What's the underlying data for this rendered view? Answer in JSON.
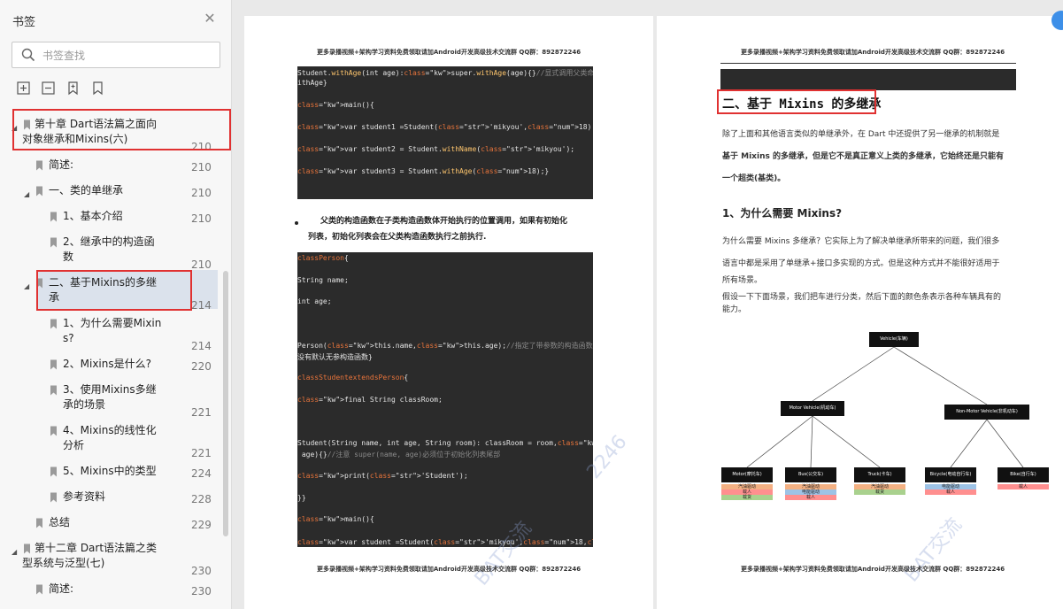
{
  "sidebar": {
    "title": "书签",
    "search_placeholder": "书签查找",
    "toc": [
      {
        "label": "第十章 Dart语法篇之面向",
        "label2": "对象继承和Mixins(六)",
        "page": "210"
      },
      {
        "label": "简述:",
        "page": "210"
      },
      {
        "label": "一、类的单继承",
        "page": "210"
      },
      {
        "label": "1、基本介绍",
        "page": "210"
      },
      {
        "label": "2、继承中的构造函",
        "label2": "数",
        "page": "210"
      },
      {
        "label": "二、基于Mixins的多继",
        "label2": "承",
        "page": "214"
      },
      {
        "label": "1、为什么需要Mixin",
        "label2": "s?",
        "page": "214"
      },
      {
        "label": "2、Mixins是什么?",
        "page": "220"
      },
      {
        "label": "3、使用Mixins多继",
        "label2": "承的场景",
        "page": "221"
      },
      {
        "label": "4、Mixins的线性化",
        "label2": "分析",
        "page": "221"
      },
      {
        "label": "5、Mixins中的类型",
        "page": "224"
      },
      {
        "label": "参考资料",
        "page": "228"
      },
      {
        "label": "总结",
        "page": "229"
      },
      {
        "label": "第十二章 Dart语法篇之类",
        "label2": "型系统与泛型(七)",
        "page": "230"
      },
      {
        "label": "简述:",
        "page": "230"
      }
    ]
  },
  "page_header": "更多录播视频+架构学习资料免费领取请加Android开发高级技术交流群 QQ群：892872246",
  "left_page": {
    "code1": [
      "Student.withAge(int age):super.withAge(age){}//显式调用父类命名构造函数 w",
      "ithAge}",
      "",
      "main(){",
      "",
      "var student1 =Student('mikyou',18);",
      "",
      "var student2 = Student.withName('mikyou');",
      "",
      "var student3 = Student.withAge(18);}"
    ],
    "bullet_line1": "父类的构造函数在子类构造函数体开始执行的位置调用，如果有初始化",
    "bullet_line2": "列表，初始化列表会在父类构造函数执行之前执行.",
    "code2": [
      "classPerson{",
      "",
      "String name;",
      "",
      "int age;",
      "",
      "",
      "",
      "Person(this.name,this.age);//指定了带参数的构造函数为主构造函数，那么父类中就",
      "没有默认无参构造函数}",
      "",
      "classStudentextendsPerson{",
      "",
      "final String classRoom;",
      "",
      "",
      "",
      "Student(String name, int age, String room): classRoom = room,super(name,",
      " age){}//注意 super(name, age)必须位于初始化列表尾部",
      "",
      "print('Student');",
      "",
      "}}",
      "",
      "main(){",
      "",
      "var student =Student('mikyou',18,'三年级八班');}"
    ],
    "watermark1": "2246",
    "watermark2": "BAT交流"
  },
  "right_page": {
    "heading": "二、基于 Mixins 的多继承",
    "para1_l1": "除了上面和其他语言类似的单继承外，在 Dart 中还提供了另一继承的机制就是",
    "para1_l2": "基于 Mixins 的多继承，但是它不是真正意义上类的多继承，它始终还是只能有",
    "para1_l3": "一个超类(基类)。",
    "subhead": "1、为什么需要 Mixins?",
    "para2_l1": "为什么需要 Mixins 多继承？它实际上为了解决单继承所带来的问题，我们很多",
    "para2_l2": "语言中都是采用了单继承+接口多实现的方式。但是这种方式并不能很好适用于",
    "para2_l3": "所有场景。",
    "para3_l1": "假设一下下面场景，我们把车进行分类，然后下面的颜色条表示各种车辆具有的",
    "para3_l2": "能力。",
    "diagram": {
      "root": "Vehicle(车辆)",
      "mid_left": "Motor Vehicle(机动车)",
      "mid_right": "Non-Motor Vehicle(非机动车)",
      "leaves": [
        {
          "name": "Motor(摩托车)",
          "tags": [
            {
              "t": "汽油驱动",
              "c": "#f4b183"
            },
            {
              "t": "载人",
              "c": "#ff8f8f"
            },
            {
              "t": "载货",
              "c": "#a9d18e"
            }
          ]
        },
        {
          "name": "Bus(公交车)",
          "tags": [
            {
              "t": "汽油驱动",
              "c": "#f4b183"
            },
            {
              "t": "电能驱动",
              "c": "#9dc3e6"
            },
            {
              "t": "载人",
              "c": "#ff8f8f"
            }
          ]
        },
        {
          "name": "Truck(卡车)",
          "tags": [
            {
              "t": "汽油驱动",
              "c": "#f4b183"
            },
            {
              "t": "载货",
              "c": "#a9d18e"
            }
          ]
        },
        {
          "name": "Bicycle(电动自行车)",
          "tags": [
            {
              "t": "电能驱动",
              "c": "#9dc3e6"
            },
            {
              "t": "载人",
              "c": "#ff8f8f"
            }
          ]
        },
        {
          "name": "Bike(自行车)",
          "tags": [
            {
              "t": "载人",
              "c": "#ff8f8f"
            }
          ]
        }
      ]
    },
    "watermark": "BAT交流"
  }
}
